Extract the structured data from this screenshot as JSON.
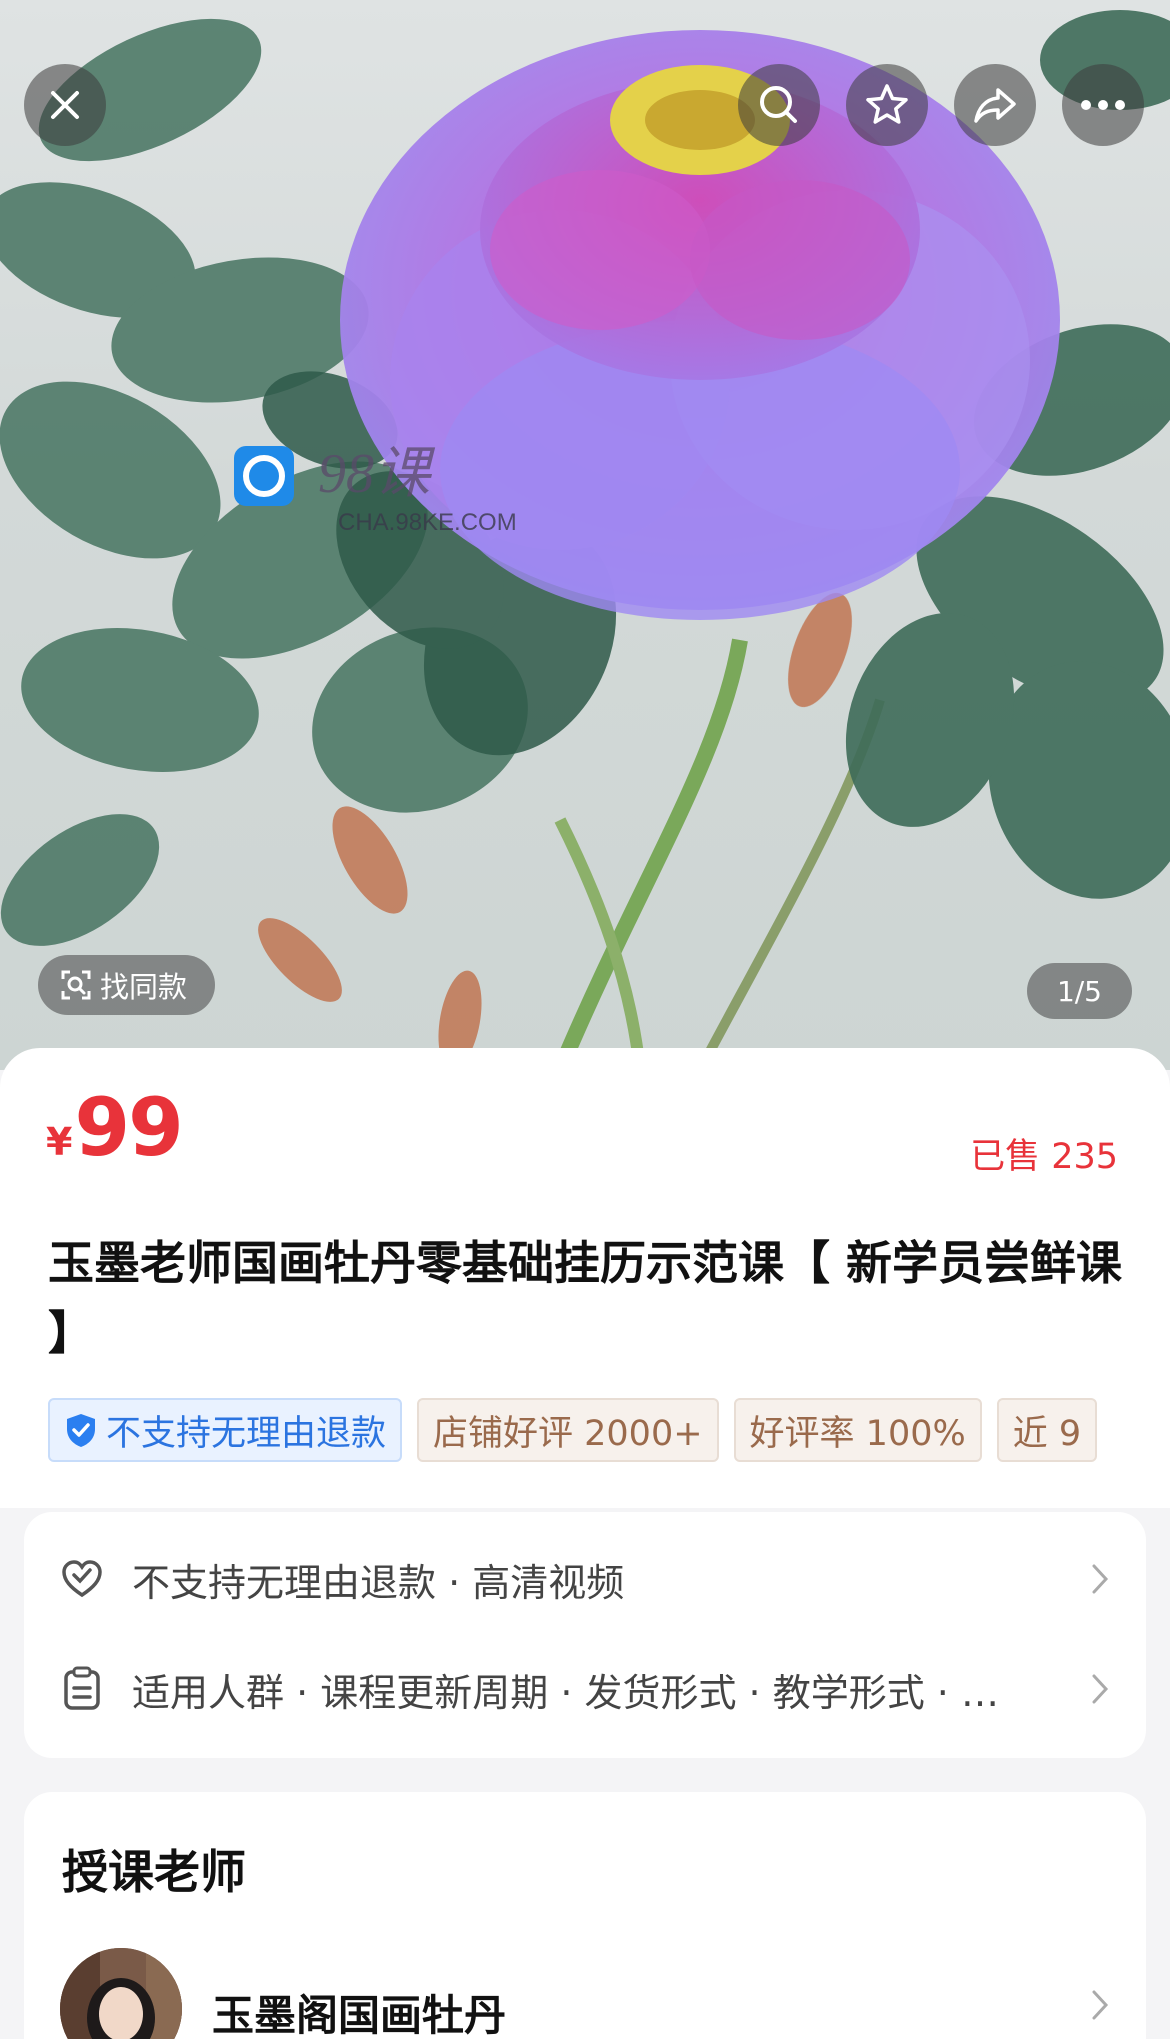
{
  "hero": {
    "watermark_main": "98课",
    "watermark_url": "CHA.98KE.COM",
    "find_same_label": "找同款",
    "pager": "1/5",
    "icons": [
      "close-icon",
      "search-icon",
      "star-icon",
      "share-icon",
      "more-icon"
    ]
  },
  "product": {
    "currency": "¥",
    "price": "99",
    "sold": "已售 235",
    "title": "玉墨老师国画牡丹零基础挂历示范课【 新学员尝鲜课 】",
    "tags": [
      {
        "label": "不支持无理由退款",
        "style": "blue"
      },
      {
        "label": "店铺好评 2000+",
        "style": "beige"
      },
      {
        "label": "好评率 100%",
        "style": "beige"
      },
      {
        "label": "近 9",
        "style": "beige"
      }
    ]
  },
  "service": {
    "row1": "不支持无理由退款 · 高清视频",
    "row2": "适用人群 · 课程更新周期 · 发货形式 · 教学形式 · …"
  },
  "teacher": {
    "heading": "授课老师",
    "name": "玉墨阁国画牡丹"
  },
  "colors": {
    "price_red": "#e8333a",
    "tag_blue": "#2b74e0",
    "tag_beige": "#9a6a4c",
    "peony_purple": "#b46ee0"
  }
}
